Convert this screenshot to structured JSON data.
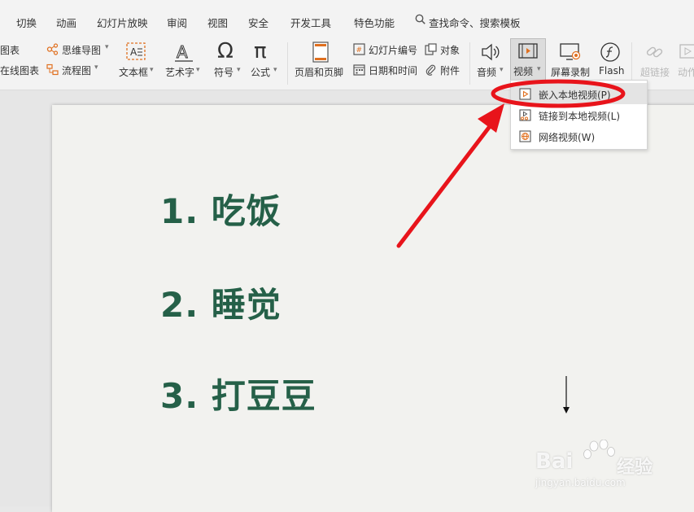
{
  "menu": {
    "items": [
      "切换",
      "动画",
      "幻灯片放映",
      "审阅",
      "视图",
      "安全",
      "开发工具",
      "特色功能"
    ],
    "search_label": "查找命令、搜索模板"
  },
  "toolbar": {
    "chart_label": "图表",
    "online_chart_label": "在线图表",
    "mindmap_label": "思维导图",
    "flowchart_label": "流程图",
    "textbox_label": "文本框",
    "wordart_label": "艺术字",
    "symbol_label": "符号",
    "formula_label": "公式",
    "header_footer_label": "页眉和页脚",
    "slide_number_label": "幻灯片编号",
    "date_time_label": "日期和时间",
    "object_label": "对象",
    "attachment_label": "附件",
    "audio_label": "音频",
    "video_label": "视频",
    "screen_record_label": "屏幕录制",
    "flash_label": "Flash",
    "hyperlink_label": "超链接",
    "action_label": "动作"
  },
  "video_menu": {
    "items": [
      "嵌入本地视频(P)",
      "链接到本地视频(L)",
      "网络视频(W)"
    ]
  },
  "slide": {
    "lines": [
      "1. 吃饭",
      "2. 睡觉",
      "3. 打豆豆"
    ]
  },
  "watermark": {
    "brand": "Bai",
    "brand_cn": "经验",
    "url": "jingyan.baidu.com"
  },
  "colors": {
    "slide_text": "#256048",
    "annotation": "#e8141b"
  }
}
